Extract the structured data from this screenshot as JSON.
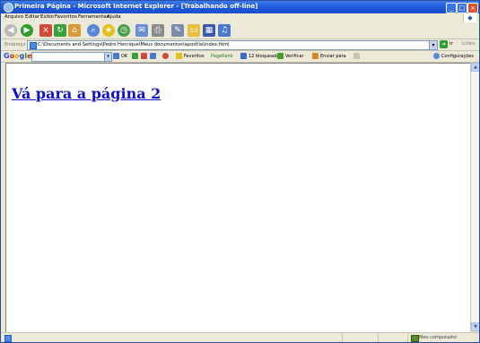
{
  "window": {
    "title": "Primeira Página - Microsoft Internet Explorer - [Trabalhando off-line]",
    "controls": {
      "minimize": "_",
      "maximize": "□",
      "close": "×"
    }
  },
  "menu": [
    "Arquivo",
    "Editar",
    "Exibir",
    "Favoritos",
    "Ferramentas",
    "Ajuda"
  ],
  "address": {
    "label": "Endereço",
    "url": "C:\\Documents and Settings\\Pedro Henrique\\Meus documentos\\apostila\\index.html",
    "go_label": "Ir",
    "links_label": "Links"
  },
  "google_bar": {
    "logo": [
      "G",
      "o",
      "o",
      "g",
      "l",
      "e"
    ],
    "ok_label": "OK",
    "favorites_label": "Favoritos",
    "pagerank_label": "PageRank",
    "blocked_label": "12 bloqueado",
    "check_label": "Verificar",
    "send_label": "Enviar para",
    "settings_label": "Configurações"
  },
  "page": {
    "link_text": "Vá para a página 2"
  },
  "status": {
    "zone": "Meu computador"
  },
  "icons": {
    "back": "back-arrow-icon",
    "forward": "forward-arrow-icon",
    "stop": "stop-icon",
    "refresh": "refresh-icon",
    "home": "home-icon",
    "search": "search-icon",
    "favorites": "star-icon",
    "history": "history-icon",
    "mail": "mail-icon",
    "print": "print-icon"
  }
}
